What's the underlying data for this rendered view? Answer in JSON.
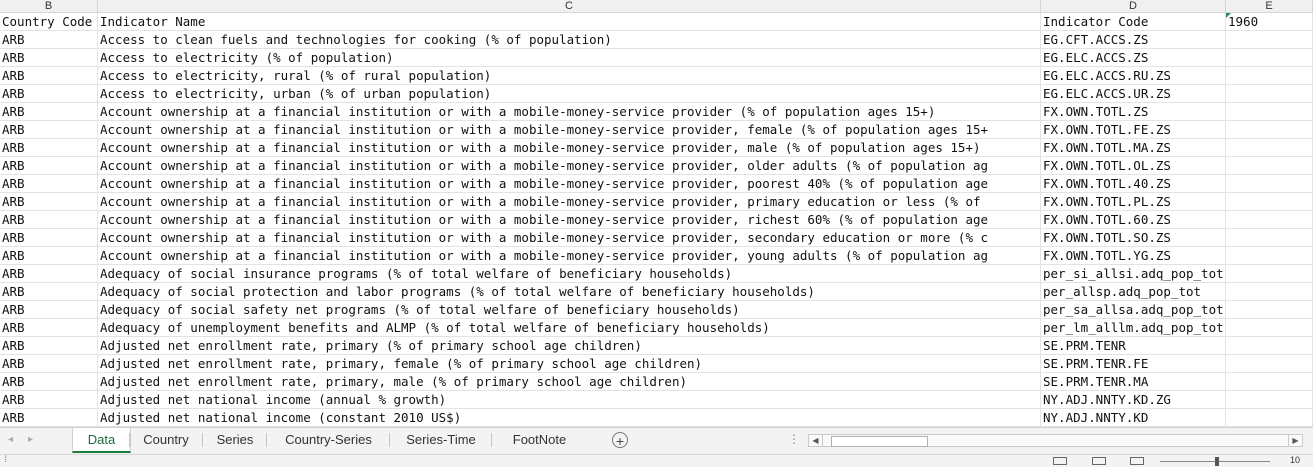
{
  "column_headers": [
    "B",
    "C",
    "D",
    "E"
  ],
  "header_row": {
    "country_code": "Country Code",
    "indicator_name": "Indicator Name",
    "indicator_code": "Indicator Code",
    "year": "1960"
  },
  "rows": [
    {
      "cc": "ARB",
      "name": "Access to clean fuels and technologies for cooking (% of population)",
      "code": "EG.CFT.ACCS.ZS"
    },
    {
      "cc": "ARB",
      "name": "Access to electricity (% of population)",
      "code": "EG.ELC.ACCS.ZS"
    },
    {
      "cc": "ARB",
      "name": "Access to electricity, rural (% of rural population)",
      "code": "EG.ELC.ACCS.RU.ZS"
    },
    {
      "cc": "ARB",
      "name": "Access to electricity, urban (% of urban population)",
      "code": "EG.ELC.ACCS.UR.ZS"
    },
    {
      "cc": "ARB",
      "name": "Account ownership at a financial institution or with a mobile-money-service provider (% of population ages 15+)",
      "code": "FX.OWN.TOTL.ZS"
    },
    {
      "cc": "ARB",
      "name": "Account ownership at a financial institution or with a mobile-money-service provider, female (% of population ages 15+",
      "code": "FX.OWN.TOTL.FE.ZS"
    },
    {
      "cc": "ARB",
      "name": "Account ownership at a financial institution or with a mobile-money-service provider, male (% of population ages 15+)",
      "code": "FX.OWN.TOTL.MA.ZS"
    },
    {
      "cc": "ARB",
      "name": "Account ownership at a financial institution or with a mobile-money-service provider, older adults (% of population ag",
      "code": "FX.OWN.TOTL.OL.ZS"
    },
    {
      "cc": "ARB",
      "name": "Account ownership at a financial institution or with a mobile-money-service provider, poorest 40% (% of population age",
      "code": "FX.OWN.TOTL.40.ZS"
    },
    {
      "cc": "ARB",
      "name": "Account ownership at a financial institution or with a mobile-money-service provider, primary education or less (% of",
      "code": "FX.OWN.TOTL.PL.ZS"
    },
    {
      "cc": "ARB",
      "name": "Account ownership at a financial institution or with a mobile-money-service provider, richest 60% (% of population age",
      "code": "FX.OWN.TOTL.60.ZS"
    },
    {
      "cc": "ARB",
      "name": "Account ownership at a financial institution or with a mobile-money-service provider, secondary education or more (% c",
      "code": "FX.OWN.TOTL.SO.ZS"
    },
    {
      "cc": "ARB",
      "name": "Account ownership at a financial institution or with a mobile-money-service provider, young adults (% of population ag",
      "code": "FX.OWN.TOTL.YG.ZS"
    },
    {
      "cc": "ARB",
      "name": "Adequacy of social insurance programs (% of total welfare of beneficiary households)",
      "code": "per_si_allsi.adq_pop_tot"
    },
    {
      "cc": "ARB",
      "name": "Adequacy of social protection and labor programs (% of total welfare of beneficiary households)",
      "code": "per_allsp.adq_pop_tot"
    },
    {
      "cc": "ARB",
      "name": "Adequacy of social safety net programs (% of total welfare of beneficiary households)",
      "code": "per_sa_allsa.adq_pop_tot"
    },
    {
      "cc": "ARB",
      "name": "Adequacy of unemployment benefits and ALMP (% of total welfare of beneficiary households)",
      "code": "per_lm_alllm.adq_pop_tot"
    },
    {
      "cc": "ARB",
      "name": "Adjusted net enrollment rate, primary (% of primary school age children)",
      "code": "SE.PRM.TENR"
    },
    {
      "cc": "ARB",
      "name": "Adjusted net enrollment rate, primary, female (% of primary school age children)",
      "code": "SE.PRM.TENR.FE"
    },
    {
      "cc": "ARB",
      "name": "Adjusted net enrollment rate, primary, male (% of primary school age children)",
      "code": "SE.PRM.TENR.MA"
    },
    {
      "cc": "ARB",
      "name": "Adjusted net national income (annual % growth)",
      "code": "NY.ADJ.NNTY.KD.ZG"
    },
    {
      "cc": "ARB",
      "name": "Adjusted net national income (constant 2010 US$)",
      "code": "NY.ADJ.NNTY.KD"
    }
  ],
  "sheet_tabs": [
    "Data",
    "Country",
    "Series",
    "Country-Series",
    "Series-Time",
    "FootNote"
  ],
  "active_tab": "Data",
  "add_sheet_label": "+",
  "more_label": "⋮",
  "zoom_label": "10",
  "accent_color": "#1a7d3f"
}
